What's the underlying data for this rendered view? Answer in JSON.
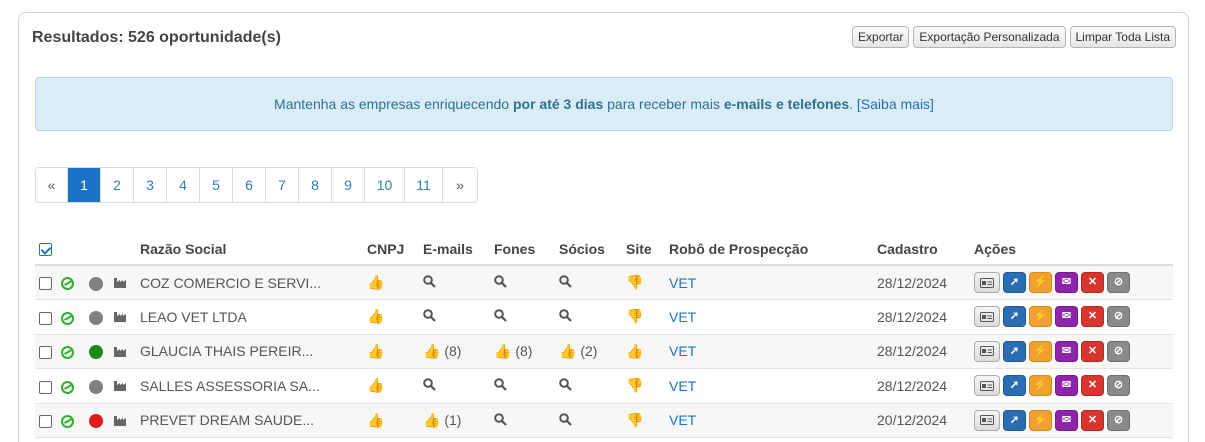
{
  "header": {
    "results_label": "Resultados: 526 oportunidade(s)",
    "buttons": [
      "Exportar",
      "Exportação Personalizada",
      "Limpar Toda Lista"
    ]
  },
  "alert": {
    "prefix": "Mantenha as empresas enriquecendo ",
    "bold1": "por até 3 dias",
    "middle": " para receber mais ",
    "bold2": "e-mails e telefones",
    "suffix": ". ",
    "link": "[Saiba mais]"
  },
  "pagination": {
    "prev": "«",
    "pages": [
      "1",
      "2",
      "3",
      "4",
      "5",
      "6",
      "7",
      "8",
      "9",
      "10",
      "11"
    ],
    "next": "»",
    "active": "1"
  },
  "table": {
    "columns": {
      "razao": "Razão Social",
      "cnpj": "CNPJ",
      "emails": "E-mails",
      "fones": "Fones",
      "socios": "Sócios",
      "site": "Site",
      "robo": "Robô de Prospecção",
      "cadastro": "Cadastro",
      "acoes": "Ações"
    },
    "rows": [
      {
        "name": "COZ COMERCIO E SERVI...",
        "status_color": "#808080",
        "emails": "",
        "fones": "",
        "socios": "",
        "robo": "VET",
        "cadastro": "28/12/2024"
      },
      {
        "name": "LEAO VET LTDA",
        "status_color": "#808080",
        "emails": "",
        "fones": "",
        "socios": "",
        "robo": "VET",
        "cadastro": "28/12/2024"
      },
      {
        "name": "GLAUCIA THAIS PEREIR...",
        "status_color": "#1a8a1a",
        "emails": "(8)",
        "fones": "(8)",
        "socios": "(2)",
        "robo": "VET",
        "cadastro": "28/12/2024"
      },
      {
        "name": "SALLES ASSESSORIA SA...",
        "status_color": "#808080",
        "emails": "",
        "fones": "",
        "socios": "",
        "robo": "VET",
        "cadastro": "28/12/2024"
      },
      {
        "name": "PREVET DREAM SAUDE...",
        "status_color": "#e31b1b",
        "emails": "(1)",
        "fones": "",
        "socios": "",
        "robo": "VET",
        "cadastro": "20/12/2024"
      }
    ]
  }
}
